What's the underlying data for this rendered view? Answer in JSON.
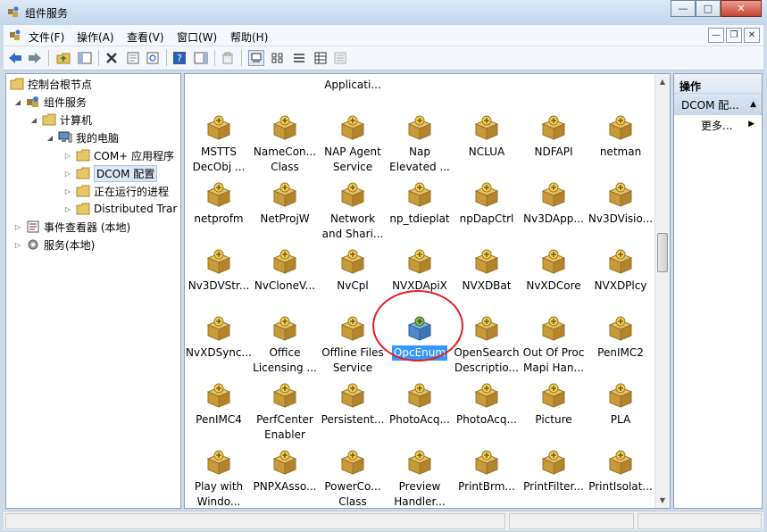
{
  "window": {
    "title": "组件服务",
    "minimize": "—",
    "maximize": "□",
    "close": "✕"
  },
  "menu": [
    "文件(F)",
    "操作(A)",
    "查看(V)",
    "窗口(W)",
    "帮助(H)"
  ],
  "mdi": {
    "minimize": "—",
    "restore": "❐",
    "close": "✕"
  },
  "tree": [
    {
      "label": "控制台根节点",
      "icon": "folder-icon",
      "expander": ""
    },
    {
      "label": "组件服务",
      "icon": "component-services-icon",
      "expander": "◢"
    },
    {
      "label": "计算机",
      "icon": "folder-icon",
      "expander": "◢"
    },
    {
      "label": "我的电脑",
      "icon": "computer-icon",
      "expander": "◢"
    },
    {
      "label": "COM+ 应用程序",
      "icon": "folder-icon",
      "expander": "▷"
    },
    {
      "label": "DCOM 配置",
      "icon": "folder-icon",
      "expander": "▷",
      "selected": true
    },
    {
      "label": "正在运行的进程",
      "icon": "folder-icon",
      "expander": "▷"
    },
    {
      "label": "Distributed Trar",
      "icon": "folder-icon",
      "expander": "▷"
    },
    {
      "label": "事件查看器 (本地)",
      "icon": "event-viewer-icon",
      "expander": "▷"
    },
    {
      "label": "服务(本地)",
      "icon": "services-gear-icon",
      "expander": "▷"
    }
  ],
  "grid_rows": [
    [
      "",
      "",
      "Applicati...",
      "",
      "",
      "",
      "",
      ""
    ],
    [
      "MSTTS\nDecObj ...",
      "NameCon...\nClass",
      "NAP Agent\nService",
      "Nap\nElevated ...",
      "NCLUA",
      "NDFAPI",
      "netman"
    ],
    [
      "netprofm",
      "NetProjW",
      "Network\nand Shari...",
      "np_tdieplat",
      "npDapCtrl",
      "Nv3DApp...",
      "Nv3DVisio..."
    ],
    [
      "Nv3DVStr...",
      "NvCloneV...",
      "NvCpl",
      "NVXDApiX",
      "NVXDBat",
      "NvXDCore",
      "NVXDPlcy"
    ],
    [
      "NvXDSync...",
      "Office\nLicensing ...",
      "Offline Files\nService",
      "OpcEnum",
      "OpenSearch\nDescriptio...",
      "Out Of Proc\nMapi Han...",
      "PenIMC2"
    ],
    [
      "PenIMC4",
      "PerfCenter\nEnabler",
      "Persistent...",
      "PhotoAcq...",
      "PhotoAcq...",
      "Picture",
      "PLA"
    ],
    [
      "Play with\nWindo...",
      "PNPXAsso...",
      "PowerCo...\nClass",
      "Preview\nHandler...",
      "PrintBrm...",
      "PrintFilter...",
      "PrintIsolat..."
    ]
  ],
  "selected_item": "OpcEnum",
  "actions": {
    "header": "操作",
    "section": "DCOM 配...",
    "section_arrow": "▲",
    "more": "更多...",
    "more_arrow": "▶"
  },
  "scroll": {
    "up": "▲",
    "down": "▼"
  },
  "colors": {
    "selection": "#3399ff",
    "annotation_circle": "#e02020"
  }
}
